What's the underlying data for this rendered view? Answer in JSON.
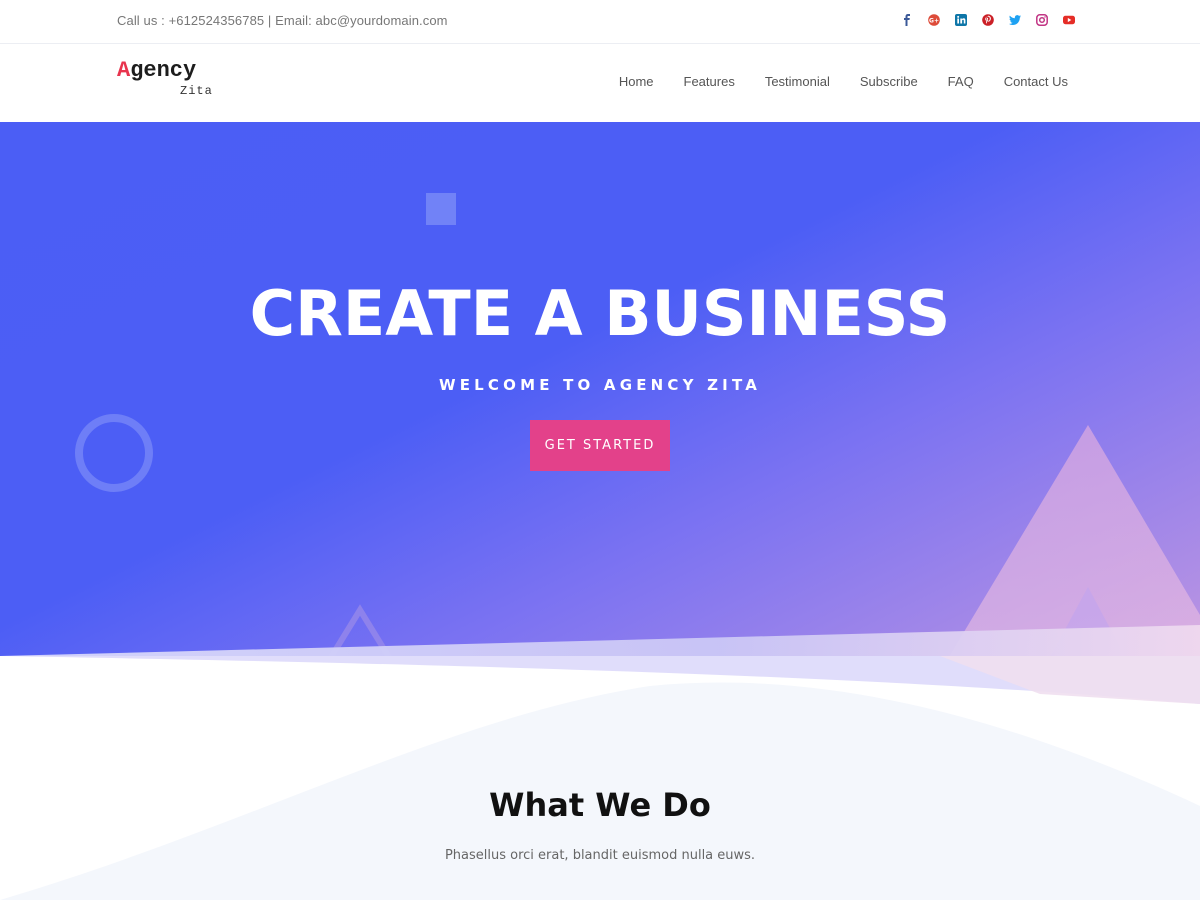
{
  "topbar": {
    "contact": "Call us : +612524356785 | Email: abc@yourdomain.com",
    "social": [
      {
        "icon": "facebook-icon",
        "color": "#3b5998"
      },
      {
        "icon": "google-plus-icon",
        "color": "#dd4b39"
      },
      {
        "icon": "linkedin-icon",
        "color": "#0e76a8"
      },
      {
        "icon": "pinterest-icon",
        "color": "#cb2027"
      },
      {
        "icon": "twitter-icon",
        "color": "#1da1f2"
      },
      {
        "icon": "instagram-icon",
        "color": "#c13584"
      },
      {
        "icon": "youtube-icon",
        "color": "#e52d27"
      }
    ]
  },
  "header": {
    "logo_letter": "A",
    "logo_rest": "gency",
    "logo_sub": "Zita",
    "nav": [
      "Home",
      "Features",
      "Testimonial",
      "Subscribe",
      "FAQ",
      "Contact Us"
    ]
  },
  "hero": {
    "title": "CREATE A BUSINESS",
    "subtitle": "WELCOME TO AGENCY ZITA",
    "cta": "GET STARTED",
    "colors": {
      "primary": "#4b5ef5",
      "accent": "#e3418a",
      "gradient_end": "#c49ae8"
    }
  },
  "what": {
    "title": "What We Do",
    "desc": "Phasellus orci erat, blandit euismod nulla euws."
  }
}
